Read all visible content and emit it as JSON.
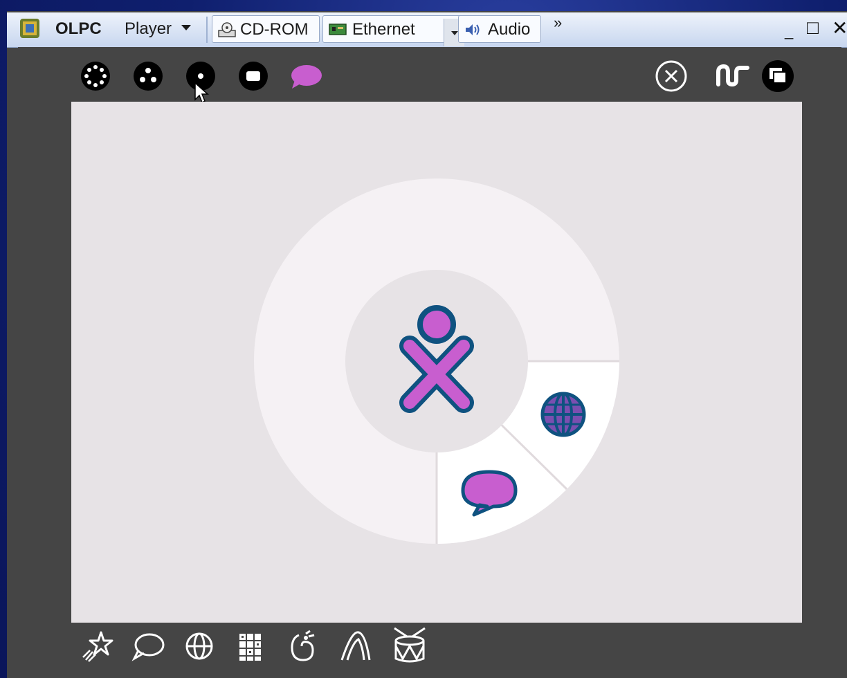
{
  "vmware_toolbar": {
    "brand": "OLPC",
    "player_menu": "Player",
    "devices": [
      {
        "label": "CD-ROM",
        "icon": "cdrom-icon"
      },
      {
        "label": "Ethernet",
        "icon": "network-card-icon"
      },
      {
        "label": "Audio",
        "icon": "speaker-icon"
      }
    ],
    "overflow_label": "»",
    "window_controls": [
      "minimize",
      "maximize",
      "close"
    ]
  },
  "sugar_frame": {
    "zoom_views": [
      "neighborhood-view-icon",
      "group-view-icon",
      "home-view-icon",
      "activity-view-icon"
    ],
    "chat_icon": "chat-bubble-icon",
    "right_controls": [
      "close-circle-icon",
      "journal-squiggle-icon",
      "window-switch-icon"
    ],
    "bottom_activities": [
      "star-shooting-icon",
      "chat-outline-icon",
      "browse-globe-icon",
      "grid-calc-icon",
      "pippy-snake-icon",
      "paint-triangle-icon",
      "tamtam-drum-icon"
    ]
  },
  "home_ring": {
    "center": "xo-person-icon",
    "segments": [
      {
        "activity": "browse-globe-icon"
      },
      {
        "activity": "chat-bubble-icon"
      }
    ]
  },
  "colors": {
    "xo_stroke": "#0f5280",
    "xo_fill": "#c85ecf",
    "frame_bg": "#454545",
    "canvas_bg": "#e7e3e6"
  }
}
